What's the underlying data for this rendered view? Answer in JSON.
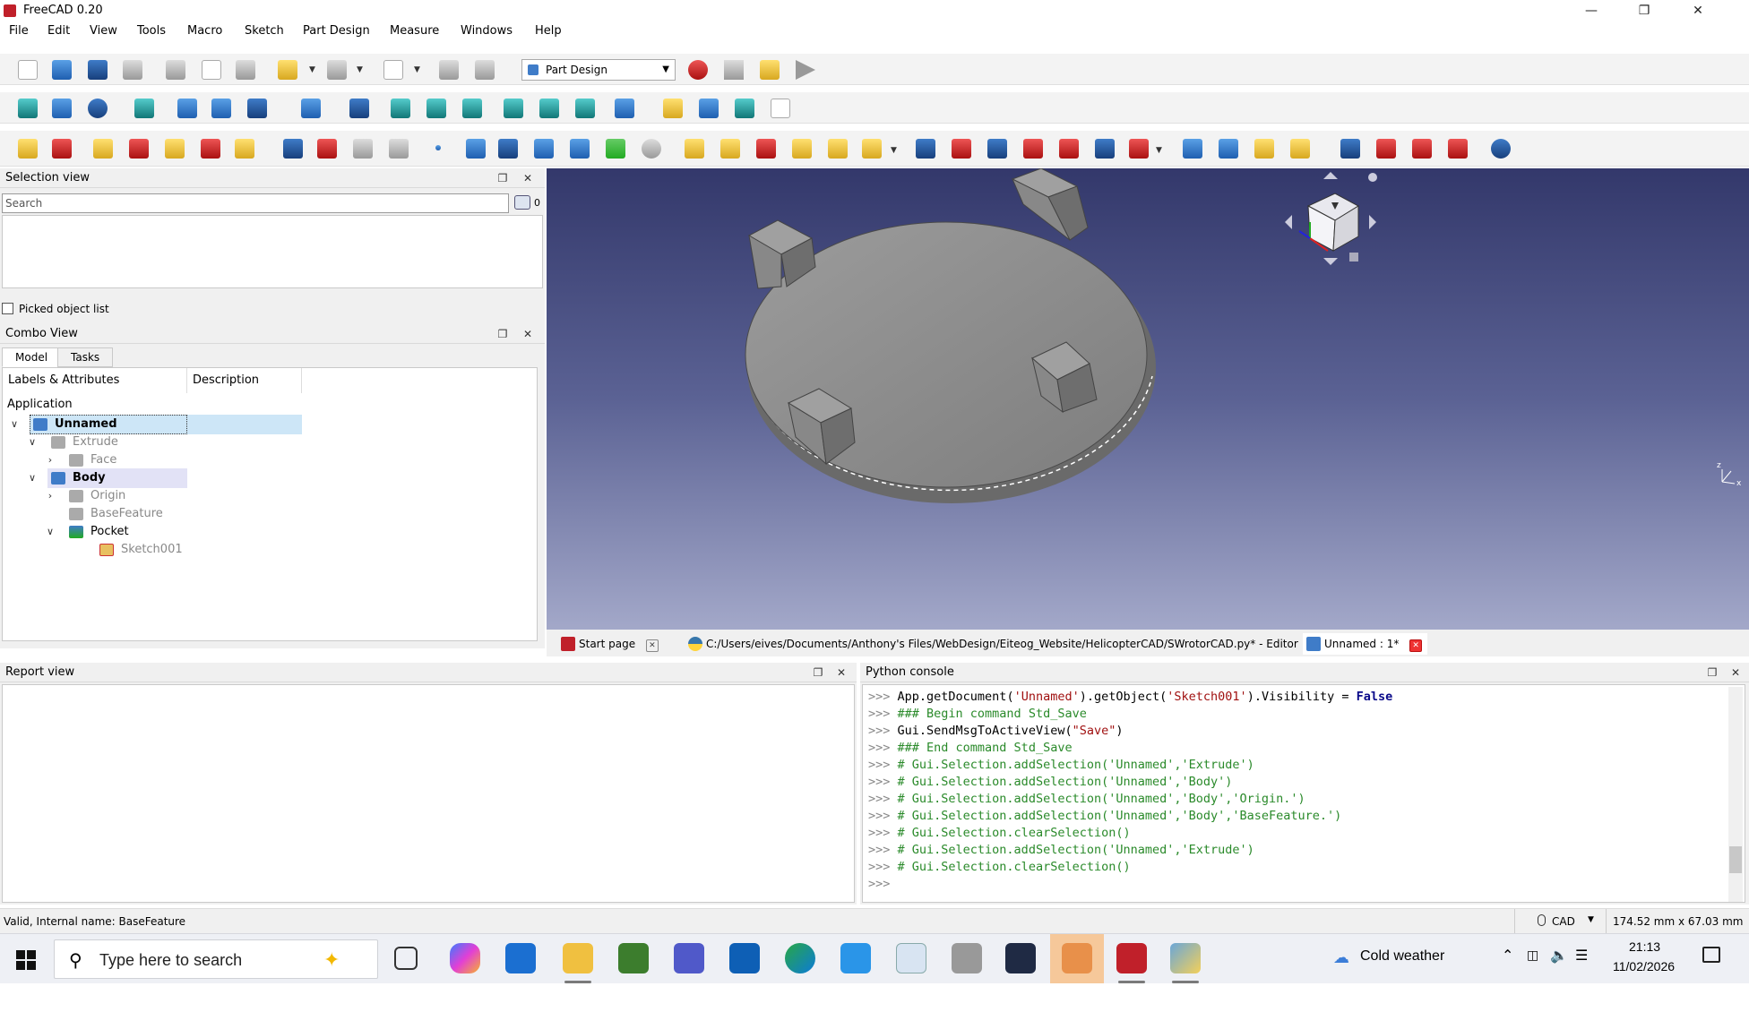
{
  "window": {
    "title": "FreeCAD 0.20"
  },
  "menu": [
    "File",
    "Edit",
    "View",
    "Tools",
    "Macro",
    "Sketch",
    "Part Design",
    "Measure",
    "Windows",
    "Help"
  ],
  "workbench": {
    "selected": "Part Design"
  },
  "selection_view": {
    "title": "Selection view",
    "search_placeholder": "Search",
    "count": "0",
    "picked_label": "Picked object list"
  },
  "combo_view": {
    "title": "Combo View",
    "tabs": [
      "Model",
      "Tasks"
    ],
    "columns": [
      "Labels & Attributes",
      "Description"
    ],
    "tree": {
      "root": "Application",
      "unnamed": "Unnamed",
      "extrude": "Extrude",
      "face": "Face",
      "body": "Body",
      "origin": "Origin",
      "basefeature": "BaseFeature",
      "pocket": "Pocket",
      "sketch": "Sketch001"
    }
  },
  "doc_tabs": {
    "start": "Start page",
    "editor": "C:/Users/eives/Documents/Anthony's Files/WebDesign/Eiteog_Website/HelicopterCAD/SWrotorCAD.py* - Editor",
    "unnamed": "Unnamed : 1*"
  },
  "report_view": {
    "title": "Report view"
  },
  "python_console": {
    "title": "Python console",
    "prompt": ">>>",
    "lines": [
      {
        "prompt": ">>> ",
        "obj": "App",
        "a": ".getDocument(",
        "s1": "'Unnamed'",
        "b": ").getObject(",
        "s2": "'Sketch001'",
        "c": ").Visibility = ",
        "kw": "False"
      },
      {
        "prompt": ">>> ",
        "text": "### Begin command Std_Save"
      },
      {
        "prompt": ">>> ",
        "a": "Gui.SendMsgToActiveView(",
        "s1": "\"Save\"",
        "b": ")"
      },
      {
        "prompt": ">>> ",
        "text": "### End command Std_Save"
      },
      {
        "prompt": ">>> ",
        "text": "# Gui.Selection.addSelection('Unnamed','Extrude')"
      },
      {
        "prompt": ">>> ",
        "text": "# Gui.Selection.addSelection('Unnamed','Body')"
      },
      {
        "prompt": ">>> ",
        "text": "# Gui.Selection.addSelection('Unnamed','Body','Origin.')"
      },
      {
        "prompt": ">>> ",
        "text": "# Gui.Selection.addSelection('Unnamed','Body','BaseFeature.')"
      },
      {
        "prompt": ">>> ",
        "text": "# Gui.Selection.clearSelection()"
      },
      {
        "prompt": ">>> ",
        "text": "# Gui.Selection.addSelection('Unnamed','Extrude')"
      },
      {
        "prompt": ">>> ",
        "text": "# Gui.Selection.clearSelection()"
      },
      {
        "prompt": ">>> ",
        "text": ""
      }
    ]
  },
  "statusbar": {
    "message": "Valid, Internal name: BaseFeature",
    "nav_style": "CAD",
    "dimensions": "174.52 mm x 67.03 mm"
  },
  "taskbar": {
    "search_placeholder": "Type here to search",
    "weather": "Cold weather",
    "time": "21:13",
    "date": "11/02/2026"
  },
  "colors": {
    "viewport_top": "#33386b",
    "viewport_bottom": "#a3a8c9",
    "selection": "#cde6f7"
  }
}
